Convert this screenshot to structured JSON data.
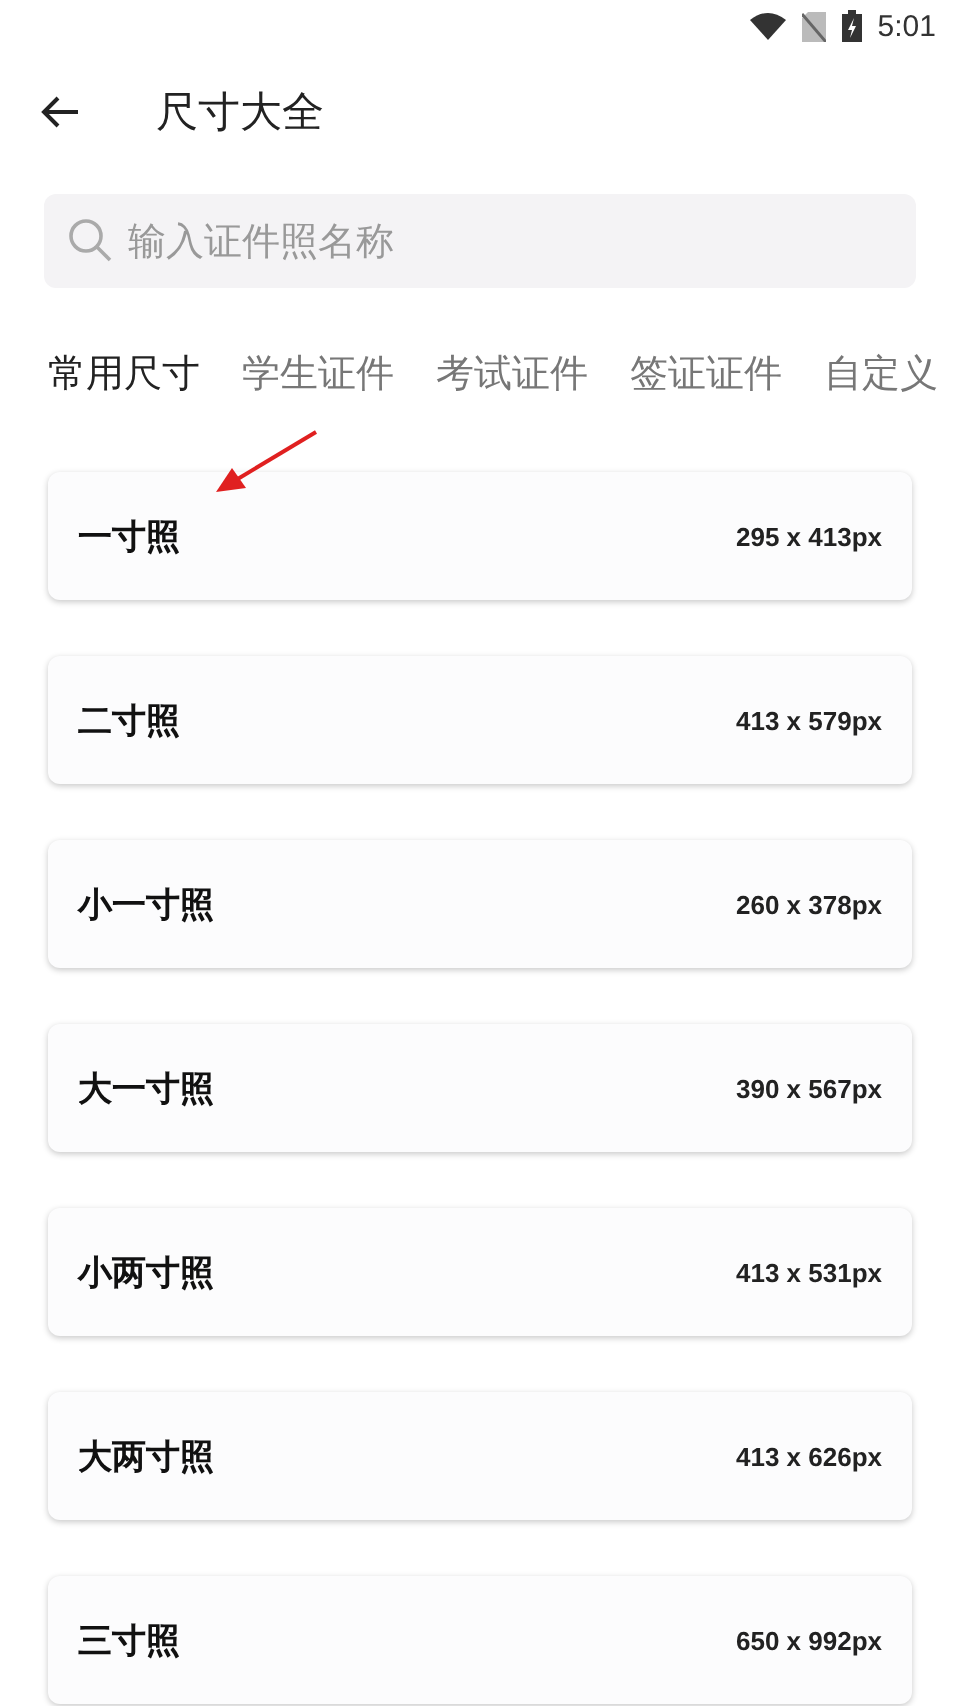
{
  "status_bar": {
    "time": "5:01"
  },
  "toolbar": {
    "title": "尺寸大全"
  },
  "search": {
    "placeholder": "输入证件照名称"
  },
  "tabs": [
    {
      "label": "常用尺寸",
      "selected": true
    },
    {
      "label": "学生证件",
      "selected": false
    },
    {
      "label": "考试证件",
      "selected": false
    },
    {
      "label": "签证证件",
      "selected": false
    },
    {
      "label": "自定义",
      "selected": false
    }
  ],
  "sizes": [
    {
      "name": "一寸照",
      "pixels": "295 x 413px"
    },
    {
      "name": "二寸照",
      "pixels": "413 x 579px"
    },
    {
      "name": "小一寸照",
      "pixels": "260 x 378px"
    },
    {
      "name": "大一寸照",
      "pixels": "390 x 567px"
    },
    {
      "name": "小两寸照",
      "pixels": "413 x 531px"
    },
    {
      "name": "大两寸照",
      "pixels": "413 x 626px"
    },
    {
      "name": "三寸照",
      "pixels": "650 x 992px"
    }
  ]
}
